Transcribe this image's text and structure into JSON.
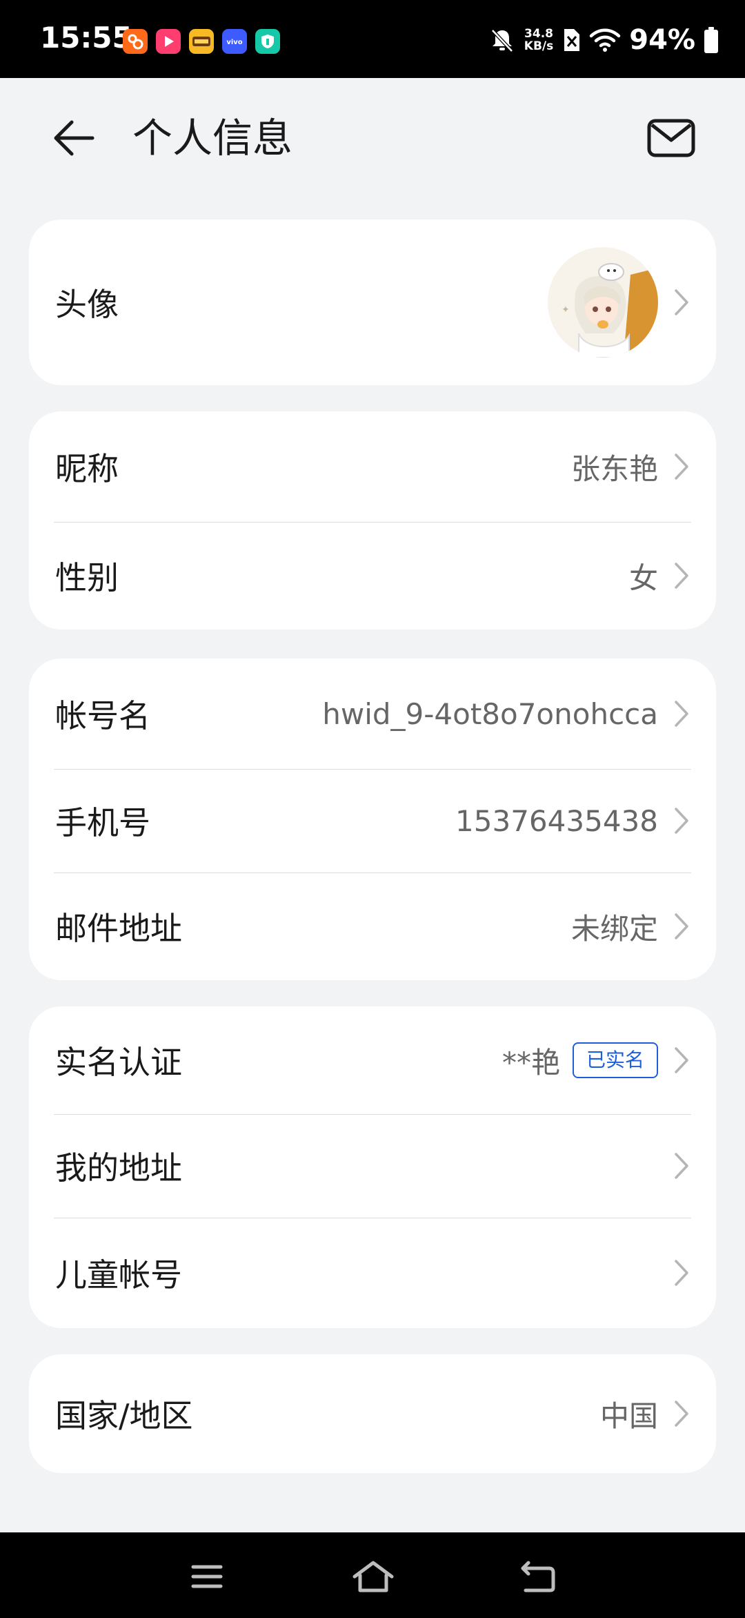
{
  "status_bar": {
    "time": "15:55",
    "net_speed_value": "34.8",
    "net_speed_unit": "KB/s",
    "battery": "94%",
    "app_icons": [
      "kuaishou-icon",
      "video-app-icon",
      "game-app-icon",
      "vivo-icon",
      "shield-app-icon"
    ]
  },
  "header": {
    "title": "个人信息"
  },
  "profile": {
    "avatar_label": "头像"
  },
  "basic": {
    "nickname_label": "昵称",
    "nickname_value": "张东艳",
    "gender_label": "性别",
    "gender_value": "女"
  },
  "account": {
    "account_name_label": "帐号名",
    "account_name_value": "hwid_9-4ot8o7onohcca",
    "phone_label": "手机号",
    "phone_value": "15376435438",
    "email_label": "邮件地址",
    "email_value": "未绑定"
  },
  "security": {
    "realname_label": "实名认证",
    "realname_value": "**艳",
    "realname_badge": "已实名",
    "address_label": "我的地址",
    "child_account_label": "儿童帐号"
  },
  "region": {
    "label": "国家/地区",
    "value": "中国"
  },
  "colors": {
    "accent": "#1d5fd6",
    "background": "#f1f3f5",
    "card": "#ffffff"
  }
}
